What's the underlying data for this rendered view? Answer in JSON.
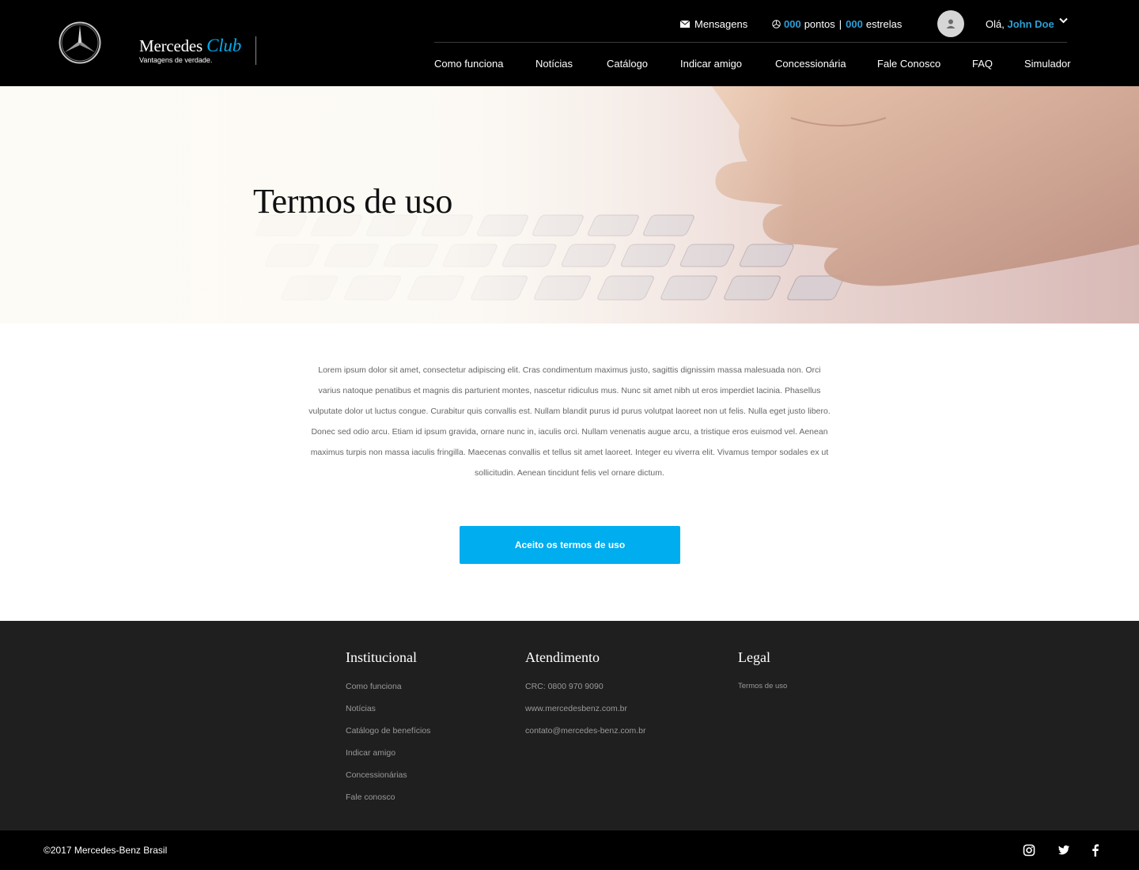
{
  "header": {
    "brand_name": "Mercedes",
    "brand_club": "Club",
    "brand_tagline": "Vantagens de verdade.",
    "messages_label": "Mensagens",
    "points_value": "000",
    "points_label": "pontos",
    "stars_value": "000",
    "stars_label": "estrelas",
    "greeting": "Olá,",
    "user_name": "John Doe",
    "nav": [
      "Como funciona",
      "Notícias",
      "Catálogo",
      "Indicar amigo",
      "Concessionária",
      "Fale Conosco",
      "FAQ",
      "Simulador"
    ]
  },
  "hero": {
    "title": "Termos de uso"
  },
  "content": {
    "paragraph": "Lorem ipsum dolor sit amet, consectetur adipiscing elit. Cras condimentum maximus justo, sagittis dignissim massa malesuada non. Orci varius natoque penatibus et magnis dis parturient montes, nascetur ridiculus mus. Nunc sit amet nibh ut eros imperdiet lacinia. Phasellus vulputate dolor ut luctus congue. Curabitur quis convallis est. Nullam blandit purus id purus volutpat laoreet non ut felis. Nulla eget justo libero. Donec sed odio arcu. Etiam id ipsum gravida, ornare nunc in, iaculis orci. Nullam venenatis augue arcu, a tristique eros euismod vel. Aenean maximus turpis non massa iaculis fringilla. Maecenas convallis et tellus sit amet laoreet. Integer eu viverra elit. Vivamus tempor sodales ex ut sollicitudin. Aenean tincidunt felis vel ornare dictum.",
    "accept_button": "Aceito os termos de uso"
  },
  "footer": {
    "institucional": {
      "title": "Institucional",
      "links": [
        "Como funciona",
        "Notícias",
        "Catálogo de benefícios",
        "Indicar amigo",
        "Concessionárias",
        "Fale conosco"
      ]
    },
    "atendimento": {
      "title": "Atendimento",
      "links": [
        "CRC: 0800 970 9090",
        "www.mercedesbenz.com.br",
        "contato@mercedes-benz.com.br"
      ]
    },
    "legal": {
      "title": "Legal",
      "links": [
        "Termos de uso"
      ]
    },
    "copyright": "©2017 Mercedes-Benz Brasil"
  },
  "icons": {
    "logo": "mercedes-star-icon",
    "messages": "envelope-icon",
    "points": "mercedes-star-small-icon",
    "avatar": "user-icon",
    "dropdown": "chevron-down-icon",
    "social": [
      "instagram-icon",
      "twitter-icon",
      "facebook-icon"
    ]
  },
  "colors": {
    "accent": "#00adef",
    "header_bg": "#000000",
    "footer_bg": "#1f1f1f"
  }
}
